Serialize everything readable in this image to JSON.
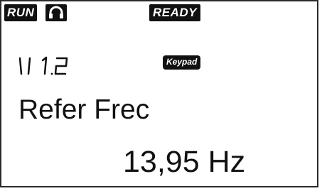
{
  "status": {
    "run": "RUN",
    "ready": "READY"
  },
  "menu": {
    "code": "V 1.2",
    "source": "Keypad"
  },
  "parameter": {
    "name": "Refer Frec",
    "value": "13,95",
    "unit": "Hz"
  },
  "icons": {
    "headset": "headset-icon"
  }
}
